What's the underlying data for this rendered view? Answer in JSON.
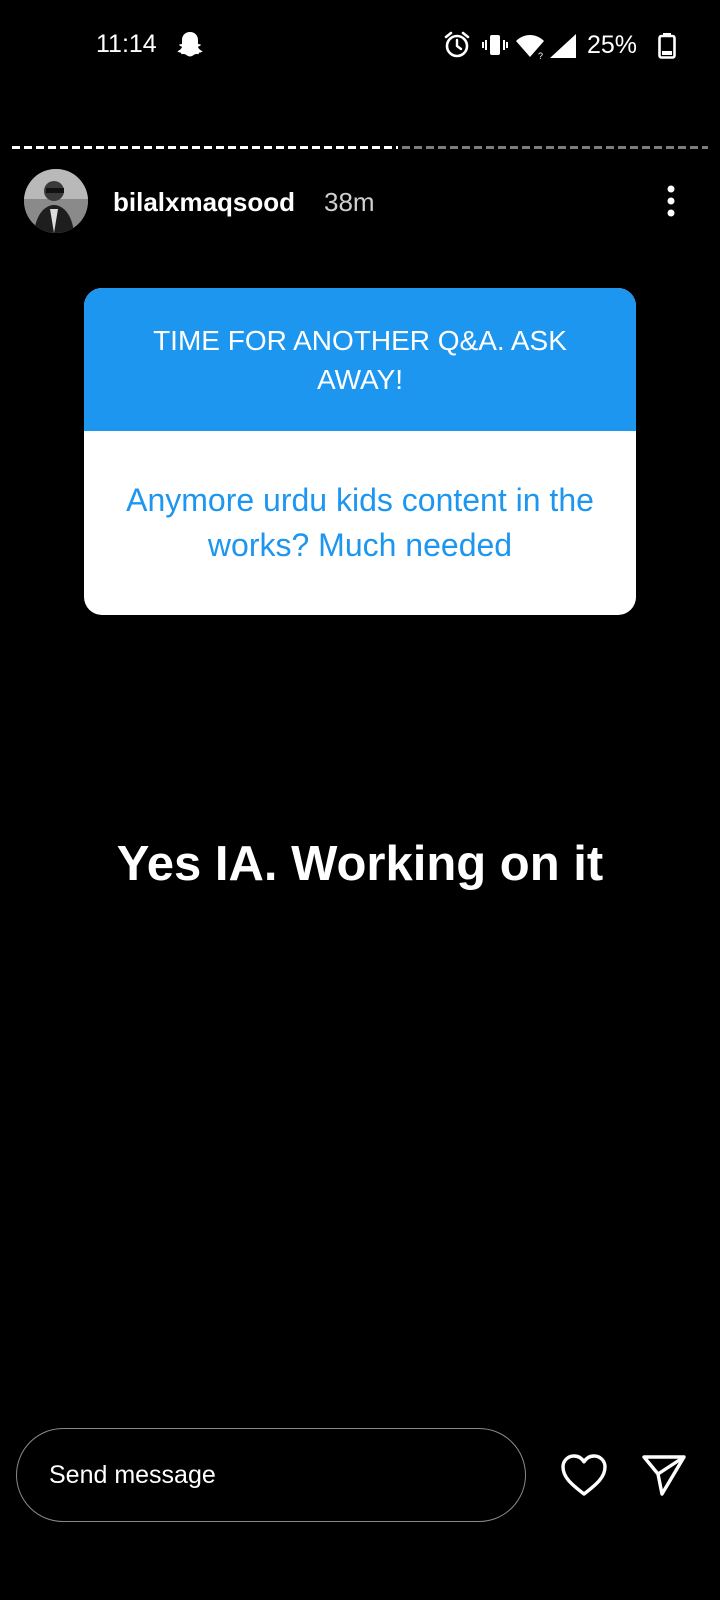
{
  "status_bar": {
    "time": "11:14",
    "battery_percent": "25%",
    "icons": [
      "snapchat-ghost-icon",
      "alarm-icon",
      "vibrate-icon",
      "wifi-icon",
      "signal-icon",
      "battery-icon"
    ]
  },
  "story": {
    "segments": [
      {
        "state": "viewed"
      },
      {
        "state": "unviewed"
      }
    ],
    "username": "bilalxmaqsood",
    "age": "38m",
    "question_sticker": {
      "prompt": "TIME FOR ANOTHER Q&A. ASK AWAY!",
      "question": "Anymore urdu kids content in the works? Much needed"
    },
    "answer_text": "Yes IA. Working on it"
  },
  "footer": {
    "message_placeholder": "Send message",
    "icons": [
      "heart-icon",
      "send-icon"
    ]
  },
  "colors": {
    "background": "#000000",
    "sticker_accent": "#1d96f0",
    "text": "#ffffff"
  }
}
